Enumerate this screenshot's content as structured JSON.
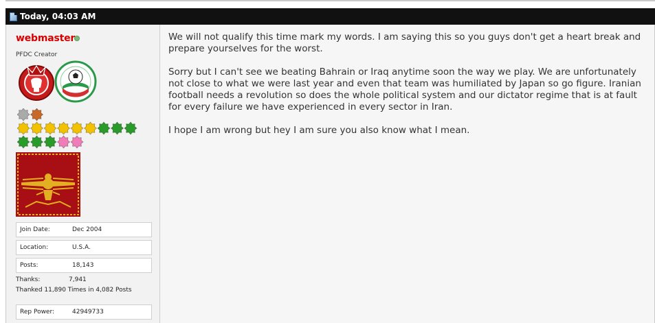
{
  "header": {
    "timestamp": "Today, 04:03 AM"
  },
  "user": {
    "name": "webmaster",
    "title": "PFDC Creator",
    "join_label": "Join Date:",
    "join_value": "Dec 2004",
    "location_label": "Location:",
    "location_value": "U.S.A.",
    "posts_label": "Posts:",
    "posts_value": "18,143",
    "thanks_label": "Thanks:",
    "thanks_value": "7,941",
    "thanked_text": "Thanked 11,890 Times in 4,082 Posts",
    "rep_label": "Rep Power:",
    "rep_value": "42949733"
  },
  "post": {
    "paragraphs": [
      "We will not qualify this time mark my words. I am saying this so you guys don't get a heart break and prepare yourselves for the worst.",
      "Sorry but I can't see we beating Bahrain or Iraq anytime soon the way we play. We are unfortunately not close to what we were last year and even that team was humiliated by Japan so go figure. Iranian football needs a revolution so does the whole political system and our dictator regime that is at fault for every failure we have experienced in every sector in Iran.",
      "I hope I am wrong but hey I am sure you also know what I mean."
    ]
  },
  "colors": {
    "header_bg": "#111111",
    "username": "#d80000",
    "online": "#7dbb7d",
    "star_gray": "#aaaaaa",
    "star_orange": "#c8692a",
    "star_gold": "#f2c200",
    "star_green": "#2a9a2a",
    "star_pink": "#f07cb8",
    "avatar_bg": "#a80f14",
    "avatar_emblem": "#e2b020"
  },
  "icons": {
    "header": "document-icon",
    "status": "online-status-icon",
    "badge1": "red-club-emblem-icon",
    "badge2": "football-federation-emblem-icon",
    "avatar": "faravahar-icon",
    "stars": "reputation-star-icon"
  }
}
